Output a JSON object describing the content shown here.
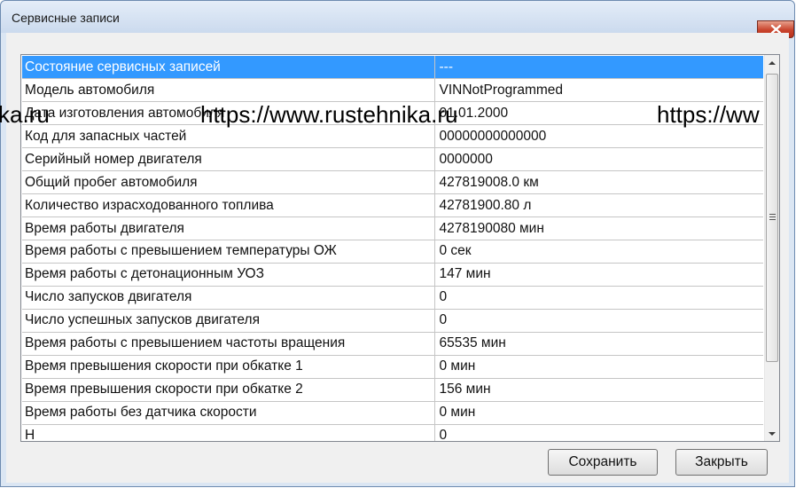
{
  "window": {
    "title": "Сервисные записи"
  },
  "rows": [
    {
      "name": "Состояние сервисных записей",
      "value": "---",
      "selected": true
    },
    {
      "name": "Модель автомобиля",
      "value": "VINNotProgrammed"
    },
    {
      "name": "Дата изготовления автомобиля",
      "value": "01.01.2000"
    },
    {
      "name": "Код для запасных частей",
      "value": "00000000000000"
    },
    {
      "name": "Серийный номер двигателя",
      "value": "0000000"
    },
    {
      "name": "Общий пробег автомобиля",
      "value": "427819008.0 км"
    },
    {
      "name": "Количество израсходованного топлива",
      "value": "42781900.80 л"
    },
    {
      "name": "Время работы двигателя",
      "value": "4278190080 мин"
    },
    {
      "name": "Время работы с превышением температуры ОЖ",
      "value": "0 сек"
    },
    {
      "name": "Время работы с детонационным УОЗ",
      "value": "147 мин"
    },
    {
      "name": "Число запусков двигателя",
      "value": "0"
    },
    {
      "name": "Число успешных запусков двигателя",
      "value": "0"
    },
    {
      "name": "Время работы с превышением частоты вращения",
      "value": "65535 мин"
    },
    {
      "name": "Время превышения скорости при обкатке 1",
      "value": "0 мин"
    },
    {
      "name": "Время превышения скорости при обкатке 2",
      "value": "156 мин"
    },
    {
      "name": "Время работы без датчика скорости",
      "value": "0 мин"
    },
    {
      "name": "Н",
      "value": "0"
    }
  ],
  "buttons": {
    "save": "Сохранить",
    "close": "Закрыть"
  },
  "watermark": {
    "left_text": "ka.ru",
    "center_text": "https://www.rustehnika.ru",
    "right_text": "https://ww"
  },
  "colors": {
    "selection": "#3399ff",
    "close_button": "#c9432c"
  }
}
